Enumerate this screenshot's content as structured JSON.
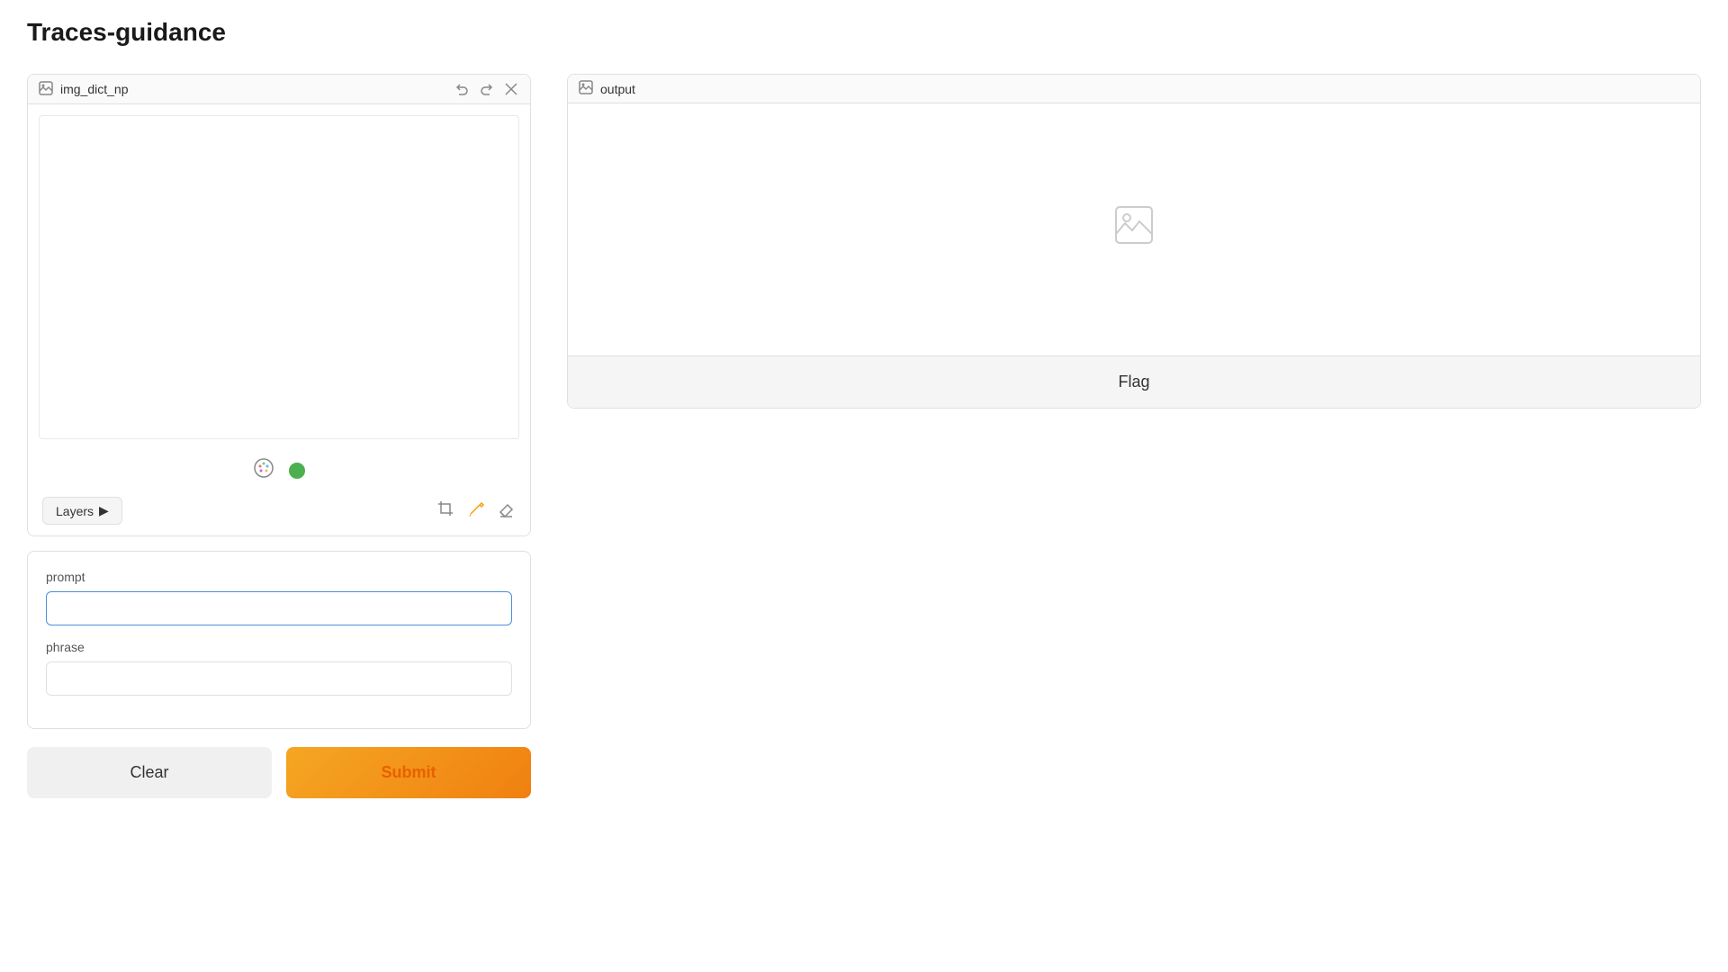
{
  "page": {
    "title": "Traces-guidance"
  },
  "left_card": {
    "title": "img_dict_np",
    "title_icon": "image-icon",
    "actions": {
      "undo_label": "↺",
      "redo_label": "↻",
      "close_label": "✕"
    }
  },
  "toolbar": {
    "palette_icon": "🎨",
    "green_dot_color": "#4caf50",
    "layers_label": "Layers",
    "layers_arrow": "▶",
    "crop_icon": "crop",
    "brush_icon": "brush",
    "eraser_icon": "eraser"
  },
  "form": {
    "prompt_label": "prompt",
    "prompt_placeholder": "",
    "phrase_label": "phrase",
    "phrase_placeholder": "",
    "clear_label": "Clear",
    "submit_label": "Submit"
  },
  "output_card": {
    "title": "output",
    "title_icon": "image-icon"
  },
  "flag_button": {
    "label": "Flag"
  }
}
